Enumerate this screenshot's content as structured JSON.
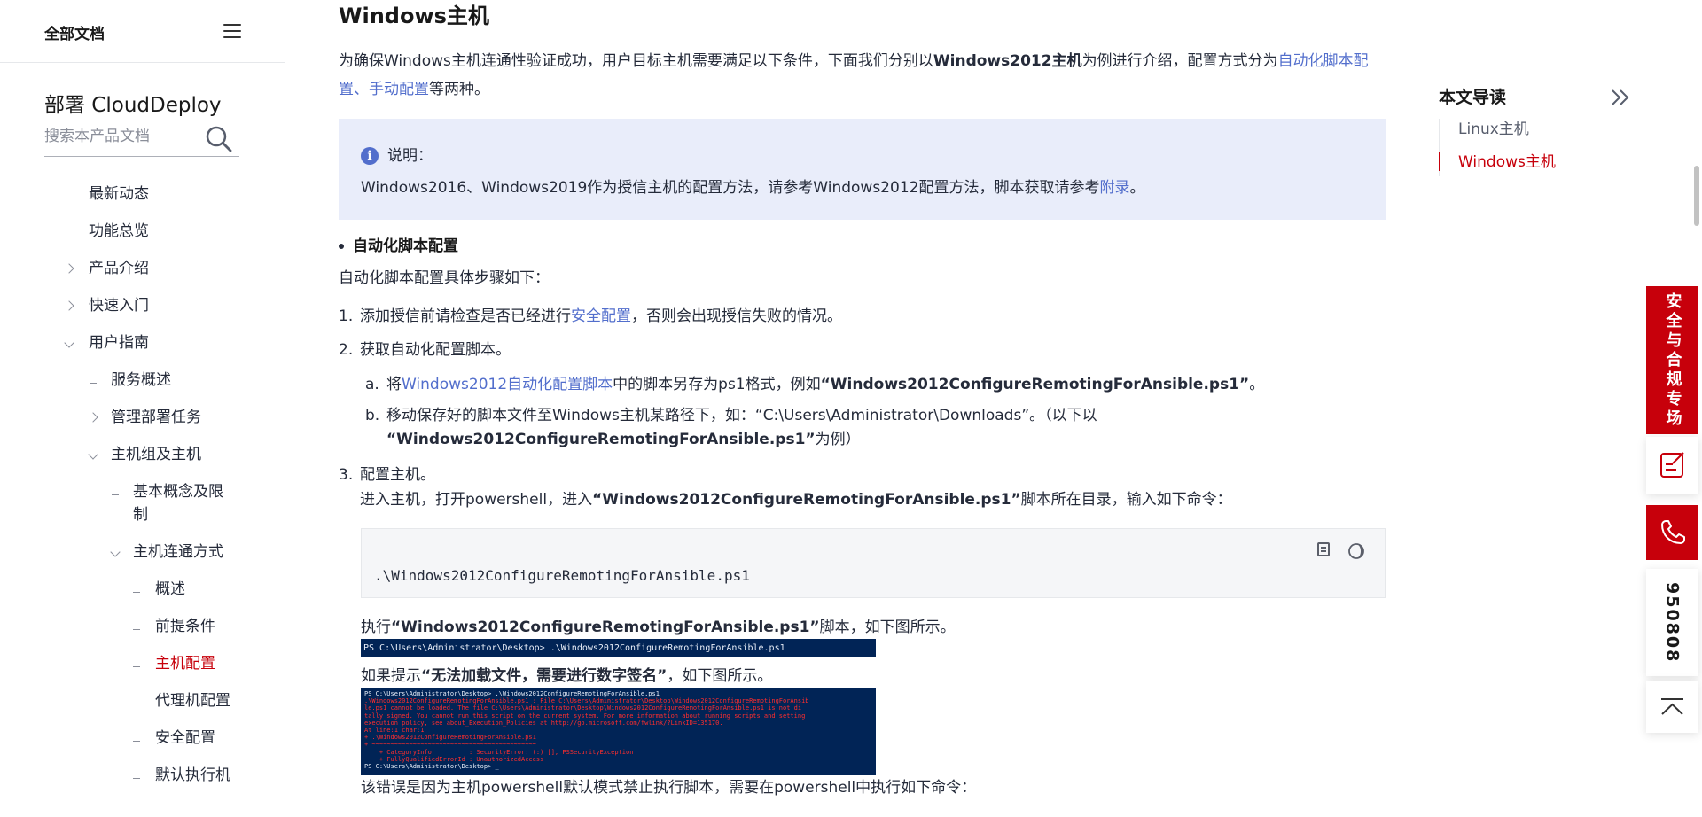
{
  "sidebar": {
    "title": "全部文档",
    "product_name": "部署 CloudDeploy",
    "search_placeholder": "搜索本产品文档",
    "items": [
      {
        "label": "最新动态"
      },
      {
        "label": "功能总览"
      },
      {
        "label": "产品介绍"
      },
      {
        "label": "快速入门"
      },
      {
        "label": "用户指南"
      },
      {
        "label": "服务概述"
      },
      {
        "label": "管理部署任务"
      },
      {
        "label": "主机组及主机"
      },
      {
        "label": "基本概念及限"
      },
      {
        "label": "制"
      },
      {
        "label": "主机连通方式"
      },
      {
        "label": "概述"
      },
      {
        "label": "前提条件"
      },
      {
        "label": "主机配置"
      },
      {
        "label": "代理机配置"
      },
      {
        "label": "安全配置"
      },
      {
        "label": "默认执行机"
      }
    ]
  },
  "main": {
    "heading": "Windows主机",
    "intro": {
      "p1": "为确保Windows主机连通性验证成功，用户目标主机需要满足以下条件，下面我们分别以",
      "bold": "Windows2012主机",
      "p2": "为例进行介绍，配置方式分为",
      "link1": "自动化脚本配置",
      "sep": "、",
      "link2": "手动配置",
      "p3": "等两种。"
    },
    "note": {
      "title": "说明：",
      "body": "Windows2016、Windows2019作为授信主机的配置方法，请参考Windows2012配置方法，脚本获取请参考",
      "link": "附录",
      "end": "。"
    },
    "section_title": "自动化脚本配置",
    "section_desc": "自动化脚本配置具体步骤如下：",
    "step1": {
      "num": "1.",
      "a": "添加授信前请检查是否已经进行",
      "link": "安全配置",
      "b": "，否则会出现授信失败的情况。"
    },
    "step2": {
      "num": "2.",
      "text": "获取自动化配置脚本。"
    },
    "step2a": {
      "num": "a.",
      "a": "将",
      "link": "Windows2012自动化配置脚本",
      "b": "中的脚本另存为ps1格式，例如",
      "bold": "“Windows2012ConfigureRemotingForAnsible.ps1”",
      "c": "。"
    },
    "step2b": {
      "num": "b.",
      "a": "移动保存好的脚本文件至Windows主机某路径下，如：“C:\\Users\\Administrator\\Downloads”。（以下以",
      "bold": "“Windows2012ConfigureRemotingForAnsible.ps1”",
      "b": "为例）"
    },
    "step3": {
      "num": "3.",
      "text": "配置主机。",
      "a": "进入主机，打开powershell，进入",
      "bold": "“Windows2012ConfigureRemotingForAnsible.ps1”",
      "b": "脚本所在目录，输入如下命令："
    },
    "code": ".\\Windows2012ConfigureRemotingForAnsible.ps1",
    "exec": {
      "a": "执行",
      "bold": "“Windows2012ConfigureRemotingForAnsible.ps1”",
      "b": "脚本，如下图所示。"
    },
    "term1": "PS C:\\Users\\Administrator\\Desktop> .\\Windows2012ConfigureRemotingForAnsible.ps1",
    "warn": {
      "a": "如果提示",
      "bold": "“无法加载文件，需要进行数字签名”",
      "b": "，如下图所示。"
    },
    "term2": {
      "line1": "PS C:\\Users\\Administrator\\Desktop> .\\Windows2012ConfigureRemotingForAnsible.ps1",
      "err": ".\\Windows2012ConfigureRemotingForAnsible.ps1 : File C:\\Users\\Administrator\\Desktop\\Windows2012ConfigureRemotingForAnsib\nle.ps1 cannot be loaded. The file C:\\Users\\Administrator\\Desktop\\Windows2012ConfigureRemotingForAnsible.ps1 is not di\ntally signed. You cannot run this script on the current system. For more information about running scripts and setting\nexecution policy, see about_Execution_Policies at http://go.microsoft.com/fwlink/?LinkID=135170.\nAt line:1 char:1\n+ .\\Windows2012ConfigureRemotingForAnsible.ps1\n+ ~~~~~~~~~~~~~~~~~~~~~~~~~~~~~~~~~~~~~~~~~~~~\n    + CategoryInfo          : SecurityError: (:) [], PSSecurityException\n    + FullyQualifiedErrorId : UnauthorizedAccess",
      "last": "PS C:\\Users\\Administrator\\Desktop> _"
    },
    "reason": "该错误是因为主机powershell默认模式禁止执行脚本，需要在powershell中执行如下命令："
  },
  "toc": {
    "title": "本文导读",
    "items": [
      {
        "label": "Linux主机"
      },
      {
        "label": "Windows主机"
      }
    ]
  },
  "floatbar": {
    "promo": "安全与合规专场",
    "hotline": "950808"
  },
  "colors": {
    "accent_red": "#c7000b",
    "link_blue": "#526ecc",
    "note_bg": "#e9edfa",
    "terminal_bg": "#012456"
  }
}
